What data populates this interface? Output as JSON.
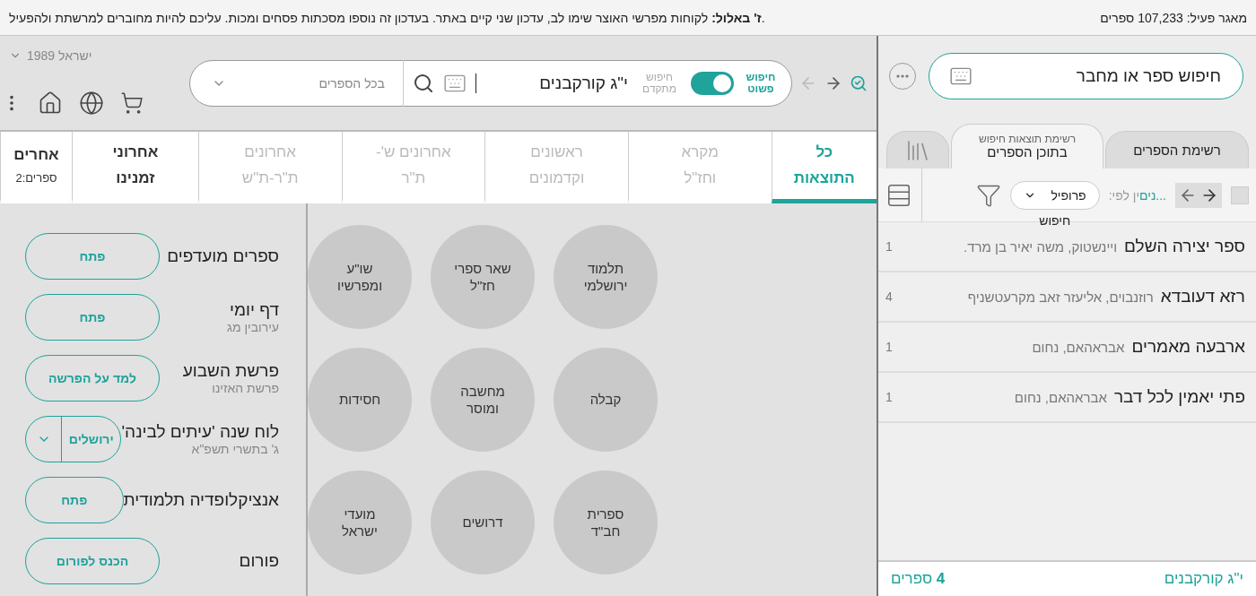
{
  "top_bar": {
    "message": ".**ז' באלול:** לקוחות מפרשי האוצר שימו לב, עדכון שני קיים באתר. בעדכון זה נוספו מסכתות פסחים ומכות. עליכם להיות מחוברים למרשתת ולהפעיל",
    "active_db": "מאגר פעיל: 107,233 ספרים"
  },
  "sidebar": {
    "search": {
      "placeholder": "חיפוש ספר או מחבר"
    },
    "tabs": [
      {
        "label": "רשימת הספרים",
        "selected": false
      },
      {
        "label": "בתוכן הספרים",
        "caption": "רשימת תוצאות חיפוש",
        "selected": true
      }
    ],
    "select_all_checked": false,
    "sort_label_highlight": "...נים",
    "sort_label": "ין לפי:",
    "sort_select": "פרופיל",
    "sort_caption": "חיפוש",
    "results": [
      {
        "title": "ספר יצירה השלם",
        "author": "ויינשטוק, משה יאיר בן מרד.",
        "count": "1"
      },
      {
        "title": "רזא דעובדא",
        "author": "רוזנבוים, אליעזר זאב מקרעטשניף",
        "count": "4"
      },
      {
        "title": "ארבעה מאמרים",
        "author": "אבראהאם, נחום",
        "count": "1"
      },
      {
        "title": "פתי יאמין לכל דבר",
        "author": "אבראהאם, נחום",
        "count": "1"
      }
    ],
    "footer_query": "י\"ג קורקבנים",
    "footer_count": "**4** ספרים"
  },
  "search": {
    "simple_label": "חיפוש פשוט",
    "advanced_label": "חיפוש מתקדם",
    "simple_on": true,
    "query": "י\"ג קורקבנים",
    "scope": "בכל הספרים"
  },
  "edition": "ישראל 1989",
  "category_tabs": [
    {
      "lines": [
        "כל",
        "התוצאות"
      ],
      "selected": true,
      "disabled": false
    },
    {
      "lines": [
        "מקרא",
        "וחז\"ל"
      ],
      "selected": false,
      "disabled": true
    },
    {
      "lines": [
        "ראשונים",
        "וקדמונים"
      ],
      "selected": false,
      "disabled": true
    },
    {
      "lines": [
        "אחרונים ש'-",
        "ת\"ר"
      ],
      "selected": false,
      "disabled": true
    },
    {
      "lines": [
        "אחרונים",
        "ת\"ר-ת\"ש"
      ],
      "selected": false,
      "disabled": true
    },
    {
      "lines": [
        "אחרוני",
        "זמנינו"
      ],
      "selected": false,
      "disabled": false
    },
    {
      "lines": [
        "אחרים",
        "ספרים:2"
      ],
      "selected": false,
      "disabled": false
    }
  ],
  "categories": [
    [
      "תלמוד",
      "ירושלמי"
    ],
    [
      "שאר ספרי",
      "חז\"ל"
    ],
    [
      "שו\"ע",
      "ומפרשיו"
    ],
    [
      "קבלה"
    ],
    [
      "מחשבה",
      "ומוסר"
    ],
    [
      "חסידות"
    ],
    [
      "ספרית",
      "חב\"ד"
    ],
    [
      "דרושים"
    ],
    [
      "מועדי",
      "ישראל"
    ]
  ],
  "widgets": [
    {
      "title": "ספרים מועדפים",
      "kind": "button",
      "action": "פתח"
    },
    {
      "title": "דף יומי",
      "subtitle": "עירובין מג",
      "kind": "button",
      "action": "פתח"
    },
    {
      "title": "פרשת השבוע",
      "subtitle": "פרשת האזינו",
      "kind": "button",
      "action": "למד על הפרשה"
    },
    {
      "title": "לוח שנה 'עיתים לבינה'",
      "subtitle": "ג' בתשרי תשפ\"א",
      "kind": "select",
      "action": "ירושלים"
    },
    {
      "title": "אנציקלופדיה תלמודית",
      "kind": "button",
      "action": "פתח"
    },
    {
      "title": "פורום",
      "kind": "button",
      "action": "הכנס לפורום"
    }
  ]
}
